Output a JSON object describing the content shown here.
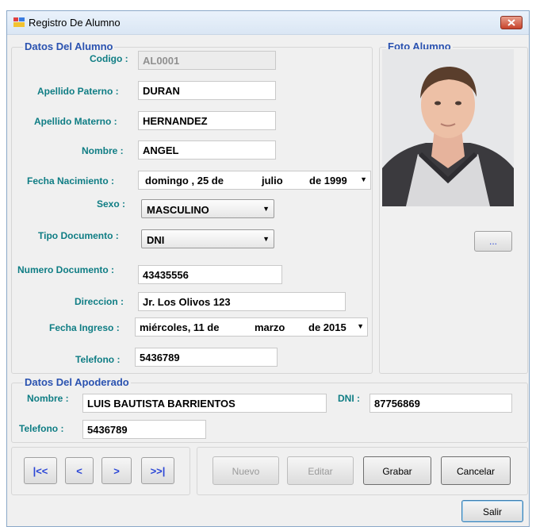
{
  "window": {
    "title": "Registro De Alumno"
  },
  "alumno": {
    "legend": "Datos Del Alumno",
    "codigo_label": "Codigo :",
    "codigo": "AL0001",
    "ap_paterno_label": "Apellido Paterno :",
    "ap_paterno": "DURAN",
    "ap_materno_label": "Apellido Materno :",
    "ap_materno": "HERNANDEZ",
    "nombre_label": "Nombre :",
    "nombre": "ANGEL",
    "fecha_nac_label": "Fecha Nacimiento :",
    "fecha_nac": {
      "dia": "domingo , 25 de",
      "mes": "julio",
      "anio": "de 1999"
    },
    "sexo_label": "Sexo :",
    "sexo": "MASCULINO",
    "tipo_doc_label": "Tipo Documento :",
    "tipo_doc": "DNI",
    "num_doc_label": "Numero Documento :",
    "num_doc": "43435556",
    "direccion_label": "Direccion :",
    "direccion": "Jr. Los Olivos 123",
    "fecha_ing_label": "Fecha Ingreso :",
    "fecha_ing": {
      "dia": "miércoles, 11 de",
      "mes": "marzo",
      "anio": "de 2015"
    },
    "telefono_label": "Telefono :",
    "telefono": "5436789"
  },
  "foto": {
    "legend": "Foto Alumno",
    "browse_label": "..."
  },
  "apoderado": {
    "legend": "Datos Del Apoderado",
    "nombre_label": "Nombre :",
    "nombre": "LUIS BAUTISTA BARRIENTOS",
    "dni_label": "DNI :",
    "dni": "87756869",
    "telefono_label": "Telefono :",
    "telefono": "5436789"
  },
  "nav": {
    "first": "|<<",
    "prev": "<",
    "next": ">",
    "last": ">>|"
  },
  "actions": {
    "nuevo": "Nuevo",
    "editar": "Editar",
    "grabar": "Grabar",
    "cancelar": "Cancelar",
    "salir": "Salir"
  }
}
